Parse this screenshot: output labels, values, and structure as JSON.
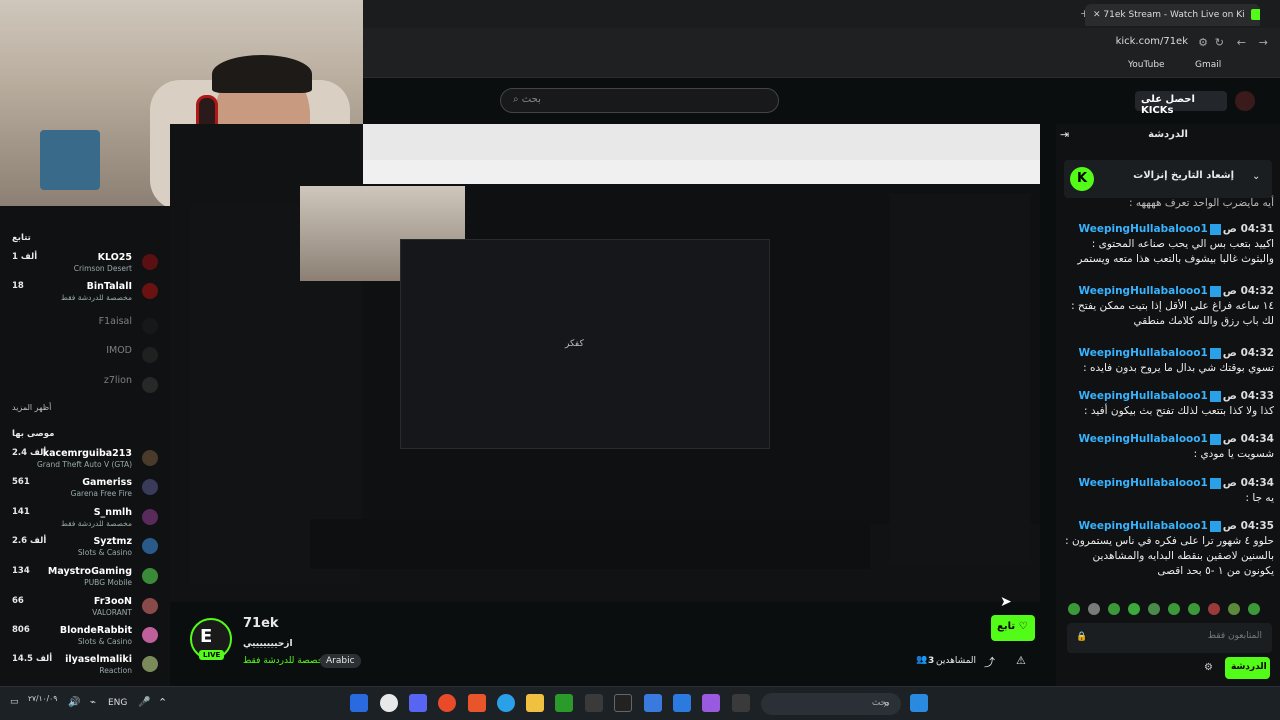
{
  "browser": {
    "tab_title": "71ek Stream - Watch Live on Ki",
    "url": "kick.com/71ek",
    "bookmarks": [
      "YouTube",
      "Gmail"
    ]
  },
  "header": {
    "search_placeholder": "بحث",
    "kicks_button": "احصل على KICKs"
  },
  "sidebar": {
    "section_following": "تتابع",
    "following": [
      {
        "viewers": "1 ألف",
        "name": "KLO25",
        "sub": "Crimson Desert"
      },
      {
        "viewers": "18",
        "name": "BinTalalI",
        "sub": "مخصصة للدردشة فقط"
      },
      {
        "viewers": "",
        "name": "F1aisal",
        "sub": ""
      },
      {
        "viewers": "",
        "name": "IMOD",
        "sub": ""
      },
      {
        "viewers": "",
        "name": "z7lion",
        "sub": ""
      }
    ],
    "show_more": "أظهر المزيد",
    "section_recommended": "موصى بها",
    "recommended": [
      {
        "viewers": "2.4 ألف",
        "name": "kacemrguiba213",
        "sub": "Grand Theft Auto V (GTA)"
      },
      {
        "viewers": "561",
        "name": "Gameriss",
        "sub": "Garena Free Fire"
      },
      {
        "viewers": "141",
        "name": "S_nmlh",
        "sub": "مخصصة للدردشة فقط"
      },
      {
        "viewers": "2.6 ألف",
        "name": "Syztmz",
        "sub": "Slots & Casino"
      },
      {
        "viewers": "134",
        "name": "MaystroGaming",
        "sub": "PUBG Mobile"
      },
      {
        "viewers": "66",
        "name": "Fr3ooN",
        "sub": "VALORANT"
      },
      {
        "viewers": "806",
        "name": "BlondeRabbit",
        "sub": "Slots & Casino"
      },
      {
        "viewers": "14.5 ألف",
        "name": "ilyaselmaliki",
        "sub": "Reaction"
      }
    ]
  },
  "stream": {
    "channel": "71ek",
    "live_label": "LIVE",
    "title": "ازحيييييييي",
    "category": "مخصصة للدردشة فقط",
    "tag": "Arabic",
    "viewers_label": "المشاهدين",
    "viewers": "3",
    "follow_label": "تابع",
    "embedded_text": "كفكر"
  },
  "chat": {
    "title": "الدردشة",
    "pinned": "إشعاد التاريخ إنزالات",
    "partial_top": "أيه مايضرب الواحد تعرف ههههه :",
    "messages": [
      {
        "time": "04:31 ص",
        "user": "WeepingHullabalooo1",
        "text": "اكييد بتعب بس الي يحب صناعه المحتوى : والبثوث غالبا بيشوف بالتعب هذا متعه ويستمر"
      },
      {
        "time": "04:32 ص",
        "user": "WeepingHullabalooo1",
        "text": "١٤ ساعه فراغ على الأقل إذا بتيت ممكن يفتح : لك باب رزق والله كلامك منطقي"
      },
      {
        "time": "04:32 ص",
        "user": "WeepingHullabalooo1",
        "text": "تسوي بوقتك شي بدال ما يروح بدون فايده :"
      },
      {
        "time": "04:33 ص",
        "user": "WeepingHullabalooo1",
        "text": "كذا ولا كذا بتتعب لذلك تفتح بث بيكون أفيد :"
      },
      {
        "time": "04:34 ص",
        "user": "WeepingHullabalooo1",
        "text": "شسويت يا مودي :"
      },
      {
        "time": "04:34 ص",
        "user": "WeepingHullabalooo1",
        "text": "يه جا :"
      },
      {
        "time": "04:35 ص",
        "user": "WeepingHullabalooo1",
        "text": "حلوو ٤ شهور ترا على فكره في ناس يستمرون : بالسنين لاصقين بنقطه البدايه والمشاهدين يكونون من ١ -٥ بحد اقصى"
      }
    ],
    "input_placeholder": "المتابعون فقط",
    "send_label": "الدردشة"
  },
  "taskbar": {
    "search": "بحث",
    "lang": "ENG",
    "date": "٢٧/١٠/٠٩"
  },
  "colors": {
    "accent": "#53fc18",
    "username": "#38b3ff"
  }
}
